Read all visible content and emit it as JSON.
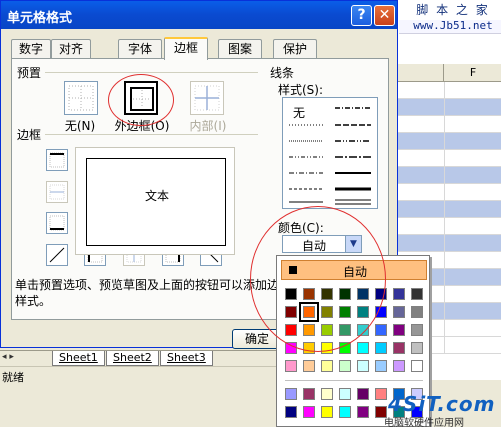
{
  "dialog": {
    "title": "单元格格式",
    "help_btn": "?",
    "close_btn": "✕",
    "tabs": [
      "数字",
      "对齐",
      "字体",
      "边框",
      "图案",
      "保护"
    ],
    "active_tab": "边框",
    "preset_group": "预置",
    "presets": [
      {
        "label": "无(N)",
        "state": "normal"
      },
      {
        "label": "外边框(O)",
        "state": "selected"
      },
      {
        "label": "内部(I)",
        "state": "disabled"
      }
    ],
    "border_group": "边框",
    "preview_text": "文本",
    "line_group": "线条",
    "style_label": "样式(S):",
    "style_none": "无",
    "color_label": "颜色(C):",
    "color_value": "自动",
    "help_text": "单击预置选项、预览草图及上面的按钮可以添加边框样式。",
    "ok_label": "确定"
  },
  "palette": {
    "auto_label": "自动",
    "rows": [
      [
        "#000000",
        "#993300",
        "#333300",
        "#003300",
        "#003366",
        "#000080",
        "#333399",
        "#333333"
      ],
      [
        "#800000",
        "#ff6600",
        "#808000",
        "#008000",
        "#008080",
        "#0000ff",
        "#666699",
        "#808080"
      ],
      [
        "#ff0000",
        "#ff9900",
        "#99cc00",
        "#339966",
        "#33cccc",
        "#3366ff",
        "#800080",
        "#969696"
      ],
      [
        "#ff00ff",
        "#ffcc00",
        "#ffff00",
        "#00ff00",
        "#00ffff",
        "#00ccff",
        "#993366",
        "#c0c0c0"
      ],
      [
        "#ff99cc",
        "#ffcc99",
        "#ffff99",
        "#ccffcc",
        "#ccffff",
        "#99ccff",
        "#cc99ff",
        "#ffffff"
      ],
      [
        "#9999ff",
        "#993366",
        "#ffffcc",
        "#ccffff",
        "#660066",
        "#ff8080",
        "#0066cc",
        "#ccccff"
      ],
      [
        "#000080",
        "#ff00ff",
        "#ffff00",
        "#00ffff",
        "#800080",
        "#800000",
        "#008080",
        "#0000ff"
      ]
    ],
    "selected": "#ff6600"
  },
  "sheet": {
    "column_f": "F",
    "tabs": [
      "Sheet1",
      "Sheet2",
      "Sheet3"
    ],
    "nav_arrows": "◂ ▸",
    "status": "就绪"
  },
  "watermarks": {
    "top_line1": "脚 本 之 家",
    "top_line2": "www.Jb51.net",
    "bottom_logo": "4SiT.com",
    "bottom_sub": "电脑软硬件应用网"
  }
}
